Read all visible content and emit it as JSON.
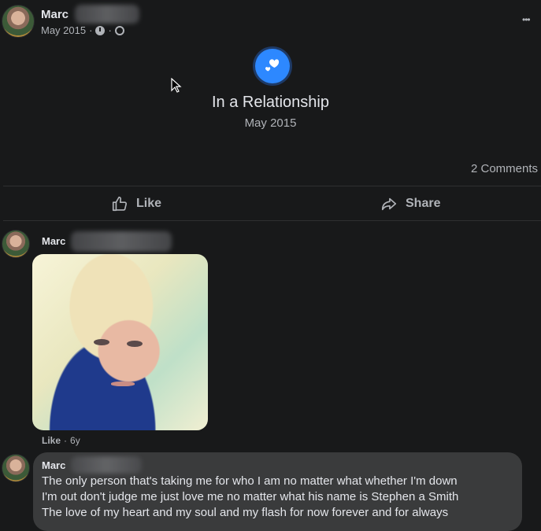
{
  "post": {
    "author": "Marc",
    "date": "May 2015",
    "meta_sep": "·",
    "more_label": "•••",
    "event_title": "In a Relationship",
    "event_date": "May 2015",
    "comments_count": "2 Comments",
    "like_label": "Like",
    "share_label": "Share"
  },
  "comment1": {
    "author": "Marc",
    "like_label": "Like",
    "time": "6y"
  },
  "comment2": {
    "author": "Marc",
    "line1": "The only person that's taking me for who I am no matter what whether I'm down",
    "line2": "I'm out don't judge me just love me no matter what his name is Stephen a Smith",
    "line3": "The love of my heart and my soul and my flash for now forever and for always"
  },
  "colors": {
    "background": "#18191a",
    "accent": "#2d88ff",
    "text": "#e4e6eb",
    "muted": "#b0b3b8"
  }
}
